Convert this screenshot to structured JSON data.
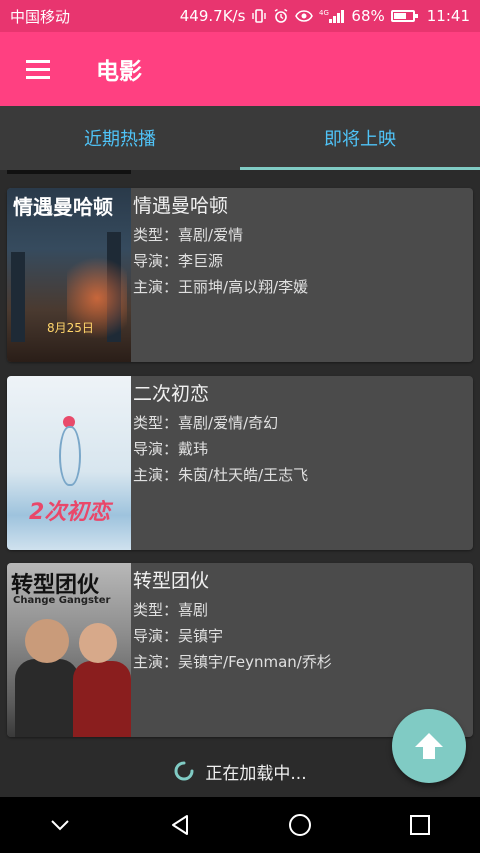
{
  "status_bar": {
    "carrier": "中国移动",
    "speed": "449.7K/s",
    "network": "4G",
    "battery": "68%",
    "battery_level": 0.68,
    "time": "11:41"
  },
  "app_bar": {
    "title": "电影",
    "menu_icon": "hamburger-menu-icon"
  },
  "tabs": [
    {
      "label": "近期热播",
      "active": false
    },
    {
      "label": "即将上映",
      "active": true
    }
  ],
  "movies": [
    {
      "title": "情遇曼哈顿",
      "genre_label": "类型：",
      "genre": "喜剧/爱情",
      "director_label": "导演：",
      "director": "李巨源",
      "cast_label": "主演：",
      "cast": "王丽坤/高以翔/李媛",
      "poster_text": "情遇曼哈顿",
      "poster_date": "8月25日"
    },
    {
      "title": "二次初恋",
      "genre_label": "类型：",
      "genre": "喜剧/爱情/奇幻",
      "director_label": "导演：",
      "director": "戴玮",
      "cast_label": "主演：",
      "cast": "朱茵/杜天皓/王志飞",
      "poster_text": "2次初恋"
    },
    {
      "title": "转型团伙",
      "genre_label": "类型：",
      "genre": "喜剧",
      "director_label": "导演：",
      "director": "吴镇宇",
      "cast_label": "主演：",
      "cast": "吴镇宇/Feynman/乔杉",
      "poster_text": "转型团伙",
      "poster_sub": "Change Gangster"
    }
  ],
  "loading": {
    "text": "正在加载中..."
  },
  "fab": {
    "icon": "arrow-up-icon"
  },
  "colors": {
    "status_bar": "#e8356f",
    "app_bar": "#ff4081",
    "tab_text": "#4fc3f7",
    "tab_indicator": "#80cbc4",
    "card": "#4b4b4b",
    "background": "#2b2b2b",
    "fab": "#80cbc4"
  }
}
